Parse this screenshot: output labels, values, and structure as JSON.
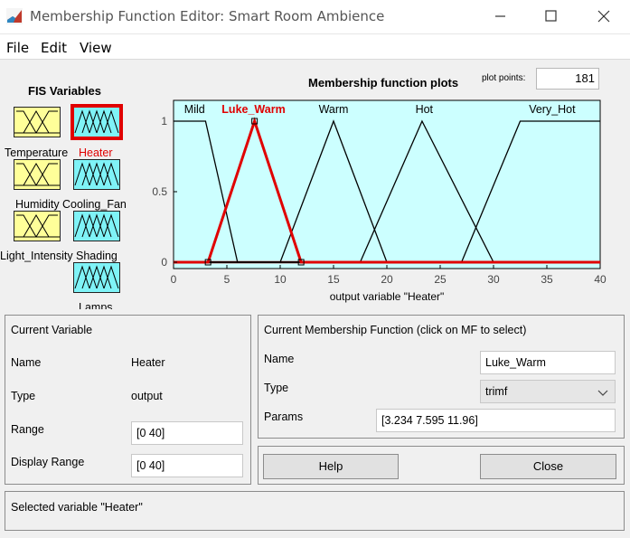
{
  "window": {
    "title": "Membership Function Editor: Smart Room Ambience",
    "minimize_icon": "minimize-icon",
    "maximize_icon": "maximize-icon",
    "close_icon": "close-icon"
  },
  "menu": [
    "File",
    "Edit",
    "View"
  ],
  "fis": {
    "heading": "FIS Variables",
    "inputs": [
      "Temperature",
      "Humidity",
      "Light_Intensity"
    ],
    "outputs": [
      "Heater",
      "Cooling_Fan",
      "Shading",
      "Lamps"
    ],
    "selected": "Heater"
  },
  "plot": {
    "title": "Membership function plots",
    "points_label": "plot points:",
    "points_value": "181",
    "xlabel": "output variable \"Heater\""
  },
  "chart_data": {
    "type": "line",
    "title": "Membership function plots",
    "xlabel": "output variable \"Heater\"",
    "ylabel": "",
    "xlim": [
      0,
      40
    ],
    "ylim": [
      0,
      1
    ],
    "x_ticks": [
      0,
      5,
      10,
      15,
      20,
      25,
      30,
      35,
      40
    ],
    "y_ticks": [
      0,
      0.5,
      1
    ],
    "series": [
      {
        "name": "Mild",
        "x": [
          0,
          3,
          6,
          40
        ],
        "y": [
          1,
          1,
          0,
          0
        ],
        "selected": false
      },
      {
        "name": "Luke_Warm",
        "x": [
          0,
          3.234,
          7.595,
          11.96,
          40
        ],
        "y": [
          0,
          0,
          1,
          0,
          0
        ],
        "selected": true
      },
      {
        "name": "Warm",
        "x": [
          0,
          10,
          15,
          20,
          40
        ],
        "y": [
          0,
          0,
          1,
          0,
          0
        ],
        "selected": false
      },
      {
        "name": "Hot",
        "x": [
          0,
          17.5,
          23.3,
          30,
          40
        ],
        "y": [
          0,
          0,
          1,
          0,
          0
        ],
        "selected": false
      },
      {
        "name": "Very_Hot",
        "x": [
          0,
          27,
          32.5,
          40
        ],
        "y": [
          0,
          0,
          1,
          1
        ],
        "selected": false
      }
    ],
    "label_x": [
      1,
      7.5,
      15,
      23.5,
      35.5
    ],
    "colors": {
      "background": "#ccffff",
      "normal": "#000000",
      "selected": "#e00000",
      "baseline": "#8b0000"
    }
  },
  "current_variable": {
    "heading": "Current Variable",
    "name_label": "Name",
    "name_value": "Heater",
    "type_label": "Type",
    "type_value": "output",
    "range_label": "Range",
    "range_value": "[0 40]",
    "display_range_label": "Display Range",
    "display_range_value": "[0 40]"
  },
  "current_mf": {
    "heading": "Current Membership Function (click on MF to select)",
    "name_label": "Name",
    "name_value": "Luke_Warm",
    "type_label": "Type",
    "type_value": "trimf",
    "params_label": "Params",
    "params_value": "[3.234 7.595 11.96]"
  },
  "buttons": {
    "help": "Help",
    "close": "Close"
  },
  "status": "Selected variable \"Heater\""
}
